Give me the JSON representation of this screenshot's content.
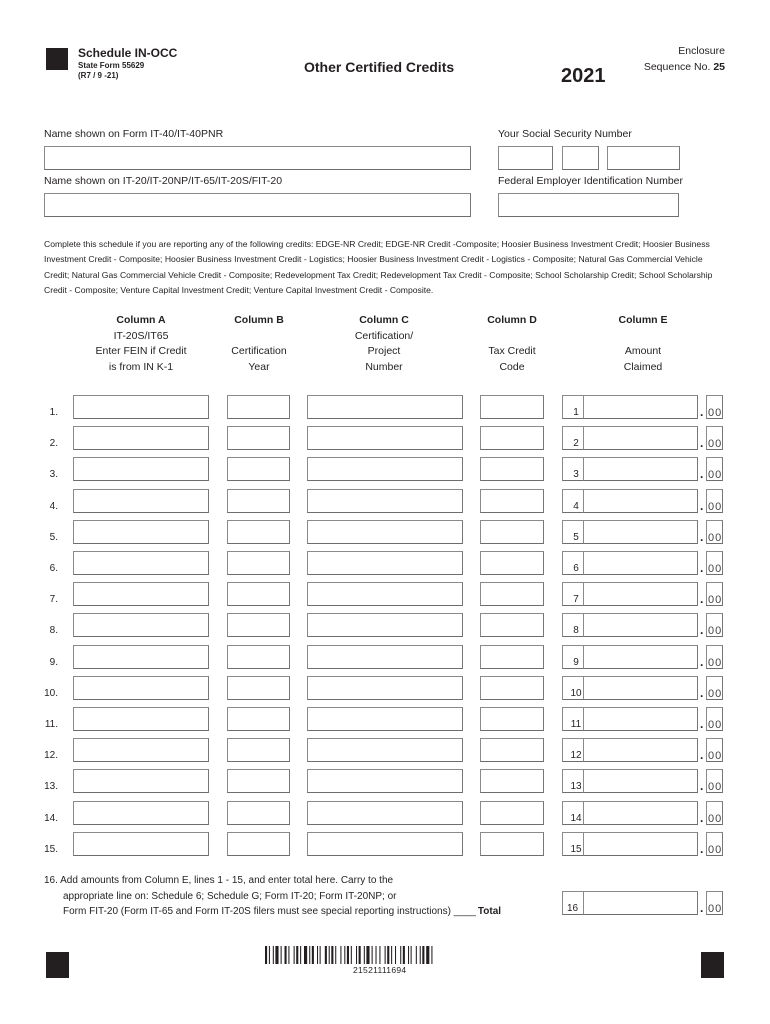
{
  "header": {
    "schedule": "Schedule IN-OCC",
    "state_form": "State Form 55629",
    "revision": "(R7 / 9 -21)",
    "title": "Other Certified Credits",
    "year": "2021",
    "enclosure_label": "Enclosure",
    "sequence_label": "Sequence No.",
    "sequence_number": "25"
  },
  "fields": {
    "name_it40_label": "Name shown on Form IT-40/IT-40PNR",
    "name_it40_value": "",
    "ssn_label": "Your Social Security Number",
    "ssn_values": [
      "",
      "",
      ""
    ],
    "name_it20_label": "Name shown on IT-20/IT-20NP/IT-65/IT-20S/FIT-20",
    "name_it20_value": "",
    "fein_label": "Federal Employer Identification Number",
    "fein_value": ""
  },
  "instructions": "Complete this schedule if you are reporting any of the following credits: EDGE-NR Credit; EDGE-NR Credit -Composite; Hoosier Business Investment Credit; Hoosier Business Investment Credit - Composite; Hoosier Business Investment Credit - Logistics; Hoosier Business Investment Credit - Logistics - Composite; Natural Gas Commercial Vehicle Credit; Natural Gas Commercial Vehicle Credit - Composite; Redevelopment Tax Credit; Redevelopment Tax Credit - Composite; School Scholarship Credit; School Scholarship Credit - Composite; Venture Capital Investment Credit; Venture Capital Investment Credit - Composite.",
  "columns": [
    {
      "title": "Column A",
      "lines": [
        "IT-20S/IT65",
        "Enter FEIN if Credit",
        "is from IN K-1"
      ]
    },
    {
      "title": "Column B",
      "lines": [
        "",
        "Certification",
        "Year"
      ]
    },
    {
      "title": "Column C",
      "lines": [
        "Certification/",
        "Project",
        "Number"
      ]
    },
    {
      "title": "Column D",
      "lines": [
        "",
        "Tax Credit",
        "Code"
      ]
    },
    {
      "title": "Column E",
      "lines": [
        "",
        "Amount",
        "Claimed"
      ]
    }
  ],
  "rows": [
    {
      "label": "1.",
      "num": "1",
      "a": "",
      "b": "",
      "c": "",
      "d": "",
      "amount": "",
      "cents": "00"
    },
    {
      "label": "2.",
      "num": "2",
      "a": "",
      "b": "",
      "c": "",
      "d": "",
      "amount": "",
      "cents": "00"
    },
    {
      "label": "3.",
      "num": "3",
      "a": "",
      "b": "",
      "c": "",
      "d": "",
      "amount": "",
      "cents": "00"
    },
    {
      "label": "4.",
      "num": "4",
      "a": "",
      "b": "",
      "c": "",
      "d": "",
      "amount": "",
      "cents": "00"
    },
    {
      "label": "5.",
      "num": "5",
      "a": "",
      "b": "",
      "c": "",
      "d": "",
      "amount": "",
      "cents": "00"
    },
    {
      "label": "6.",
      "num": "6",
      "a": "",
      "b": "",
      "c": "",
      "d": "",
      "amount": "",
      "cents": "00"
    },
    {
      "label": "7.",
      "num": "7",
      "a": "",
      "b": "",
      "c": "",
      "d": "",
      "amount": "",
      "cents": "00"
    },
    {
      "label": "8.",
      "num": "8",
      "a": "",
      "b": "",
      "c": "",
      "d": "",
      "amount": "",
      "cents": "00"
    },
    {
      "label": "9.",
      "num": "9",
      "a": "",
      "b": "",
      "c": "",
      "d": "",
      "amount": "",
      "cents": "00"
    },
    {
      "label": "10.",
      "num": "10",
      "a": "",
      "b": "",
      "c": "",
      "d": "",
      "amount": "",
      "cents": "00"
    },
    {
      "label": "11.",
      "num": "11",
      "a": "",
      "b": "",
      "c": "",
      "d": "",
      "amount": "",
      "cents": "00"
    },
    {
      "label": "12.",
      "num": "12",
      "a": "",
      "b": "",
      "c": "",
      "d": "",
      "amount": "",
      "cents": "00"
    },
    {
      "label": "13.",
      "num": "13",
      "a": "",
      "b": "",
      "c": "",
      "d": "",
      "amount": "",
      "cents": "00"
    },
    {
      "label": "14.",
      "num": "14",
      "a": "",
      "b": "",
      "c": "",
      "d": "",
      "amount": "",
      "cents": "00"
    },
    {
      "label": "15.",
      "num": "15",
      "a": "",
      "b": "",
      "c": "",
      "d": "",
      "amount": "",
      "cents": "00"
    }
  ],
  "total": {
    "line1": "16. Add amounts from Column E, lines 1 - 15, and enter total here. Carry to the",
    "line2": "appropriate line on: Schedule 6; Schedule G; Form IT-20; Form IT-20NP; or",
    "line3": "Form FIT-20 (Form IT-65 and Form IT-20S filers must see special reporting instructions) ____",
    "total_label": "Total",
    "num": "16",
    "amount": "",
    "cents": "00"
  },
  "footer": {
    "barcode_number": "21521111694"
  }
}
